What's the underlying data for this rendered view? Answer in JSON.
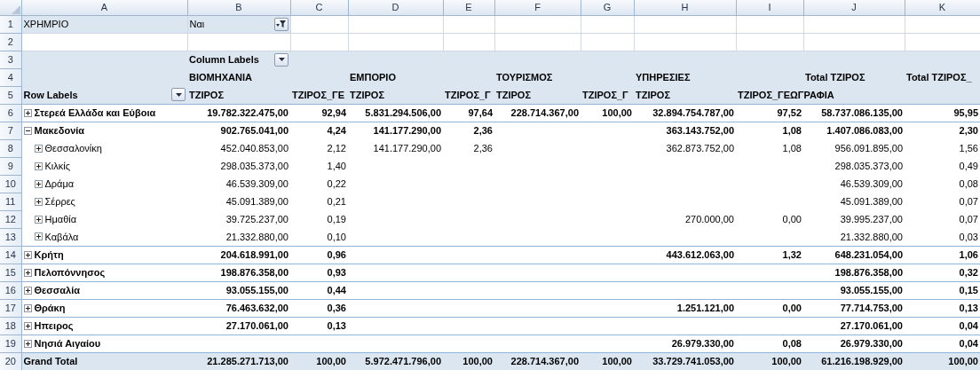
{
  "column_letters": [
    "A",
    "B",
    "C",
    "D",
    "E",
    "F",
    "G",
    "H",
    "I",
    "J",
    "K"
  ],
  "row_numbers": [
    "1",
    "2",
    "3",
    "4",
    "5",
    "6",
    "7",
    "8",
    "9",
    "10",
    "11",
    "12",
    "13",
    "14",
    "15",
    "16",
    "17",
    "18",
    "19",
    "20"
  ],
  "report_filter": {
    "field": "ΧΡΗΜΡΙΟ",
    "value": "Ναι",
    "filtered": true
  },
  "pivot": {
    "column_labels": "Column Labels",
    "row_labels": "Row Labels",
    "column_groups": [
      {
        "name": "ΒΙΟΜΗΧΑΝΙΑ",
        "measures": [
          "ΤΖΙΡΟΣ",
          "ΤΖΙΡΟΣ_ΓΕ"
        ]
      },
      {
        "name": "ΕΜΠΟΡΙΟ",
        "measures": [
          "ΤΖΙΡΟΣ",
          "ΤΖΙΡΟΣ_Γ"
        ]
      },
      {
        "name": "ΤΟΥΡΙΣΜΟΣ",
        "measures": [
          "ΤΖΙΡΟΣ",
          "ΤΖΙΡΟΣ_Γ"
        ]
      },
      {
        "name": "ΥΠΗΡΕΣΙΕΣ",
        "measures": [
          "ΤΖΙΡΟΣ",
          "ΤΖΙΡΟΣ_ΓΕΩΓΡΑΦΙΑ"
        ]
      },
      {
        "name": "Total ΤΖΙΡΟΣ"
      },
      {
        "name": "Total ΤΖΙΡΟΣ_"
      }
    ],
    "rows": [
      {
        "label": "Στερεά Ελλάδα και Εύβοια",
        "expanded": false,
        "values": {
          "b": "19.782.322.475,00",
          "c": "92,94",
          "d": "5.831.294.506,00",
          "e": "97,64",
          "f": "228.714.367,00",
          "g": "100,00",
          "h": "32.894.754.787,00",
          "i": "97,52",
          "j": "58.737.086.135,00",
          "k": "95,95"
        }
      },
      {
        "label": "Μακεδονία",
        "expanded": true,
        "values": {
          "b": "902.765.041,00",
          "c": "4,24",
          "d": "141.177.290,00",
          "e": "2,36",
          "h": "363.143.752,00",
          "i": "1,08",
          "j": "1.407.086.083,00",
          "k": "2,30"
        },
        "children": [
          {
            "label": "Θεσσαλονίκη",
            "expanded": false,
            "values": {
              "b": "452.040.853,00",
              "c": "2,12",
              "d": "141.177.290,00",
              "e": "2,36",
              "h": "362.873.752,00",
              "i": "1,08",
              "j": "956.091.895,00",
              "k": "1,56"
            }
          },
          {
            "label": "Κιλκίς",
            "expanded": false,
            "values": {
              "b": "298.035.373,00",
              "c": "1,40",
              "j": "298.035.373,00",
              "k": "0,49"
            }
          },
          {
            "label": "Δράμα",
            "expanded": false,
            "values": {
              "b": "46.539.309,00",
              "c": "0,22",
              "j": "46.539.309,00",
              "k": "0,08"
            }
          },
          {
            "label": "Σέρρες",
            "expanded": false,
            "values": {
              "b": "45.091.389,00",
              "c": "0,21",
              "j": "45.091.389,00",
              "k": "0,07"
            }
          },
          {
            "label": "Ημαθία",
            "expanded": false,
            "values": {
              "b": "39.725.237,00",
              "c": "0,19",
              "h": "270.000,00",
              "i": "0,00",
              "j": "39.995.237,00",
              "k": "0,07"
            }
          },
          {
            "label": "Καβάλα",
            "expanded": false,
            "values": {
              "b": "21.332.880,00",
              "c": "0,10",
              "j": "21.332.880,00",
              "k": "0,03"
            }
          }
        ]
      },
      {
        "label": "Κρήτη",
        "expanded": false,
        "values": {
          "b": "204.618.991,00",
          "c": "0,96",
          "h": "443.612.063,00",
          "i": "1,32",
          "j": "648.231.054,00",
          "k": "1,06"
        }
      },
      {
        "label": "Πελοπόννησος",
        "expanded": false,
        "values": {
          "b": "198.876.358,00",
          "c": "0,93",
          "j": "198.876.358,00",
          "k": "0,32"
        }
      },
      {
        "label": "Θεσσαλία",
        "expanded": false,
        "values": {
          "b": "93.055.155,00",
          "c": "0,44",
          "j": "93.055.155,00",
          "k": "0,15"
        }
      },
      {
        "label": "Θράκη",
        "expanded": false,
        "values": {
          "b": "76.463.632,00",
          "c": "0,36",
          "h": "1.251.121,00",
          "i": "0,00",
          "j": "77.714.753,00",
          "k": "0,13"
        }
      },
      {
        "label": "Ηπειρος",
        "expanded": false,
        "values": {
          "b": "27.170.061,00",
          "c": "0,13",
          "j": "27.170.061,00",
          "k": "0,04"
        }
      },
      {
        "label": "Νησιά Αιγαίου",
        "expanded": false,
        "values": {
          "h": "26.979.330,00",
          "i": "0,08",
          "j": "26.979.330,00",
          "k": "0,04"
        }
      }
    ],
    "grand_total": {
      "label": "Grand Total",
      "values": {
        "b": "21.285.271.713,00",
        "c": "100,00",
        "d": "5.972.471.796,00",
        "e": "100,00",
        "f": "228.714.367,00",
        "g": "100,00",
        "h": "33.729.741.053,00",
        "i": "100,00",
        "j": "61.216.198.929,00",
        "k": "100,00"
      }
    }
  }
}
